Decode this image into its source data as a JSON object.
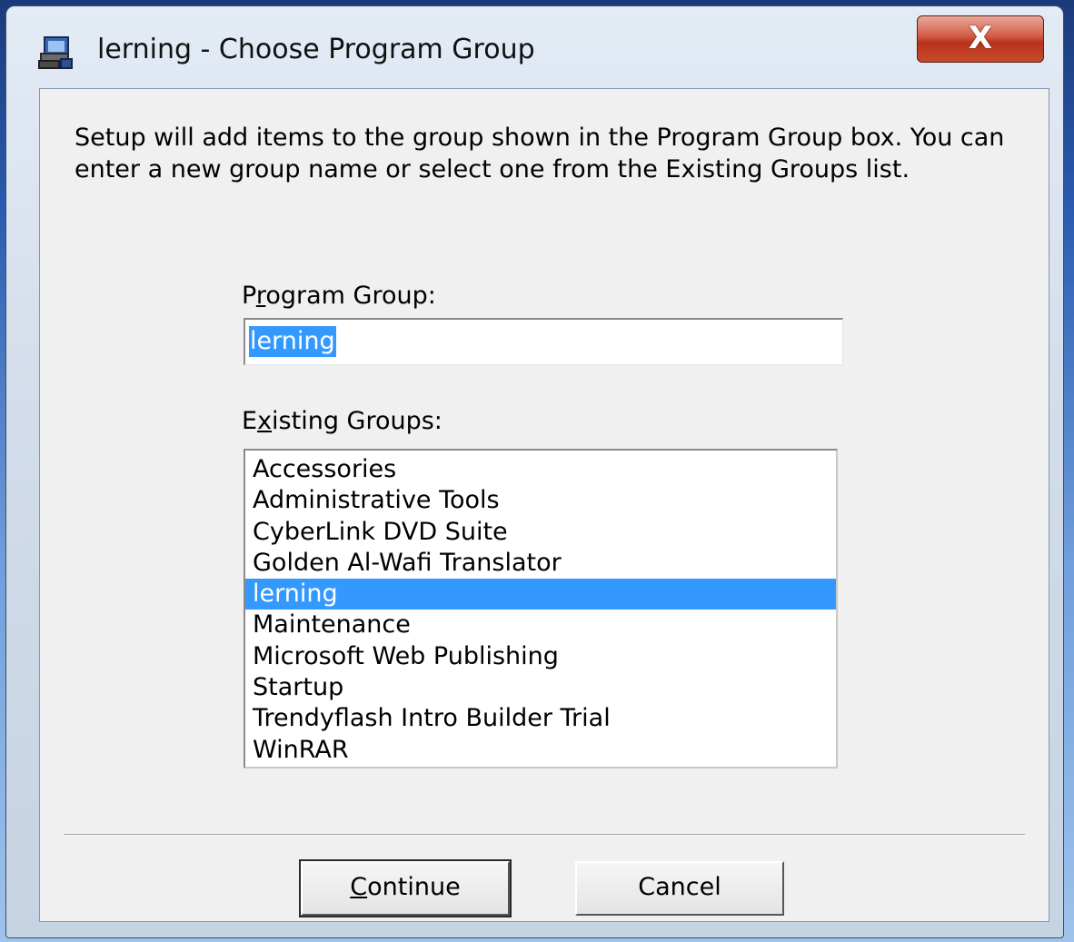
{
  "window": {
    "title": "lerning - Choose Program Group",
    "close_glyph": "X",
    "icon": "setup-computer-icon"
  },
  "instructions": "Setup will add items to the group shown in the Program Group box. You can enter a new group name or select one from the Existing Groups list.",
  "program_group": {
    "label_prefix": "P",
    "label_access": "r",
    "label_suffix": "ogram Group:",
    "value": "lerning"
  },
  "existing_groups": {
    "label_prefix": "E",
    "label_access": "x",
    "label_suffix": "isting Groups:",
    "selected": "lerning",
    "items": [
      "Accessories",
      "Administrative Tools",
      "CyberLink DVD Suite",
      "Golden Al-Wafi Translator",
      "lerning",
      "Maintenance",
      "Microsoft Web Publishing",
      "Startup",
      "Trendyflash Intro Builder Trial",
      "WinRAR"
    ]
  },
  "buttons": {
    "continue_access": "C",
    "continue_rest": "ontinue",
    "cancel": "Cancel"
  },
  "colors": {
    "selection": "#3399ff",
    "close_button": "#c84a2e"
  }
}
